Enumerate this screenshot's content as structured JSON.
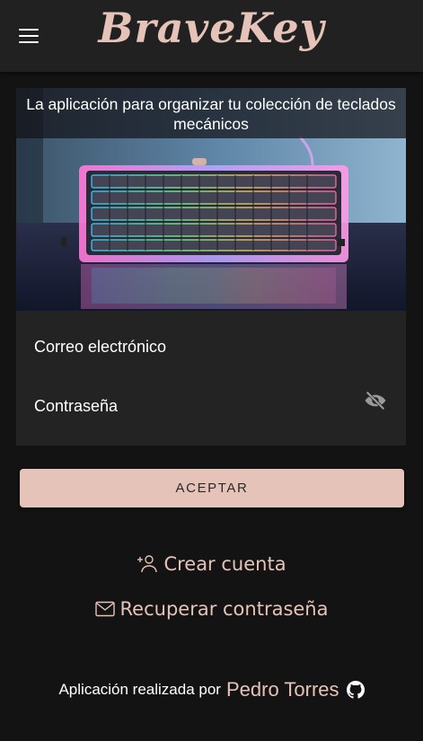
{
  "header": {
    "brand": "BraveKey",
    "menu_icon": "menu-icon"
  },
  "hero": {
    "caption": "La aplicación para organizar tu colección de teclados mecánicos"
  },
  "form": {
    "email_label": "Correo electrónico",
    "password_label": "Contraseña",
    "password_toggle_icon": "eye-off-icon"
  },
  "actions": {
    "accept_label": "ACEPTAR",
    "create_account_label": "Crear cuenta",
    "create_account_icon": "person-add-icon",
    "recover_password_label": "Recuperar contraseña",
    "recover_password_icon": "mail-icon"
  },
  "footer": {
    "prefix": "Aplicación realizada por",
    "author": "Pedro Torres",
    "author_icon": "github-icon"
  },
  "colors": {
    "accent": "#e6c3b8",
    "background": "#131313",
    "appbar": "#212121",
    "card": "#232323"
  }
}
